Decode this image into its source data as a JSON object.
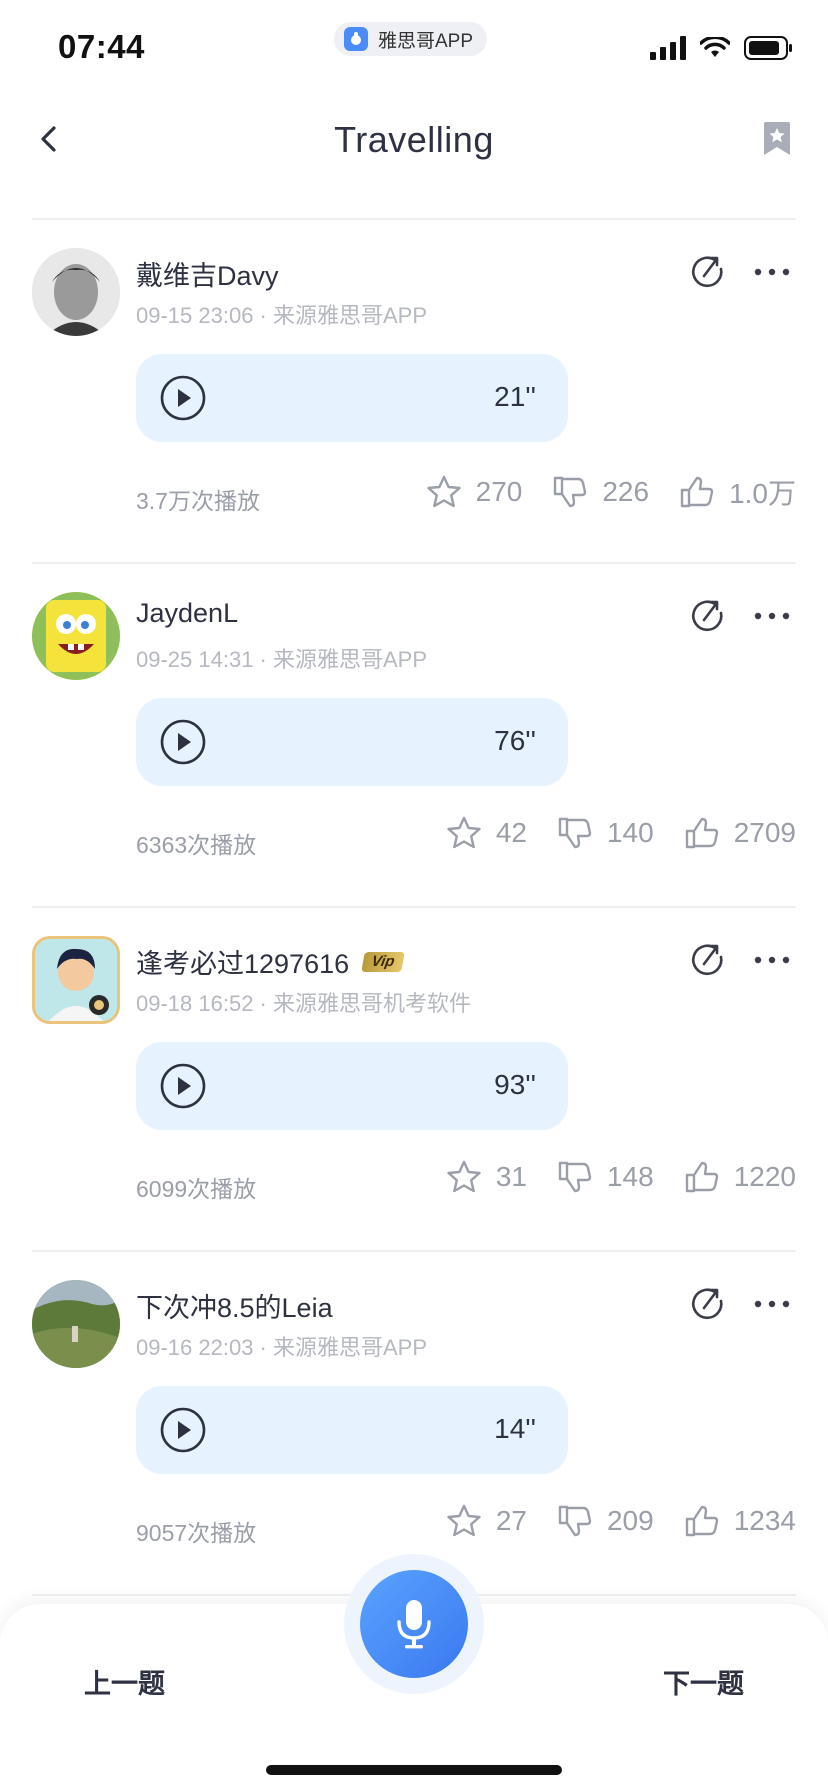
{
  "status_bar": {
    "time": "07:44",
    "app_name": "雅思哥APP"
  },
  "nav": {
    "title": "Travelling"
  },
  "posts": [
    {
      "username": "戴维吉Davy",
      "vip": false,
      "meta": "09-15 23:06 · 来源雅思哥APP",
      "duration": "21''",
      "plays": "3.7万次播放",
      "favorites": "270",
      "dislikes": "226",
      "likes": "1.0万"
    },
    {
      "username": "JaydenL",
      "vip": false,
      "meta": "09-25 14:31 · 来源雅思哥APP",
      "duration": "76''",
      "plays": "6363次播放",
      "favorites": "42",
      "dislikes": "140",
      "likes": "2709"
    },
    {
      "username": "逢考必过1297616",
      "vip": true,
      "vip_label": "Vip",
      "meta": "09-18 16:52 · 来源雅思哥机考软件",
      "duration": "93''",
      "plays": "6099次播放",
      "favorites": "31",
      "dislikes": "148",
      "likes": "1220"
    },
    {
      "username": "下次冲8.5的Leia",
      "vip": false,
      "meta": "09-16 22:03 · 来源雅思哥APP",
      "duration": "14''",
      "plays": "9057次播放",
      "favorites": "27",
      "dislikes": "209",
      "likes": "1234"
    }
  ],
  "bottom": {
    "prev_label": "上一题",
    "next_label": "下一题"
  },
  "colors": {
    "accent": "#3b78f0",
    "audio_bg": "#e6f2fd",
    "muted_text": "#9a9ea8"
  }
}
